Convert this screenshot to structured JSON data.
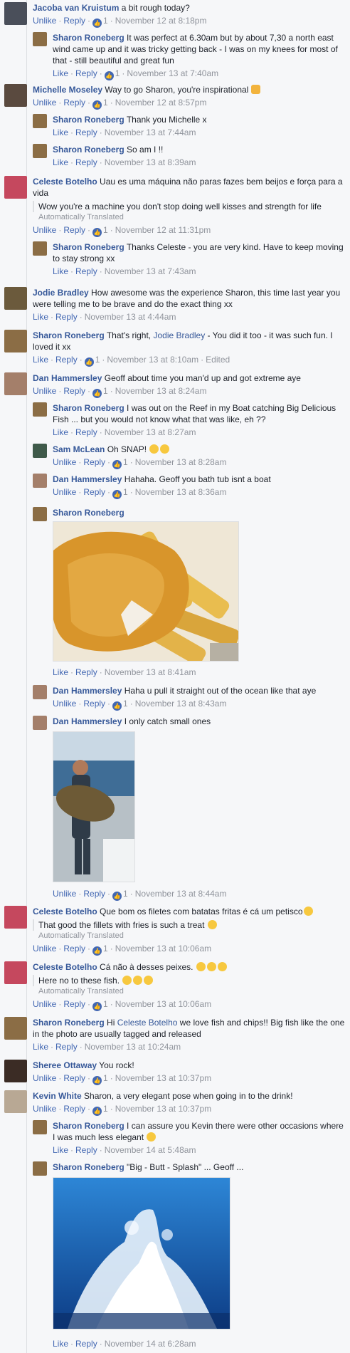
{
  "labels": {
    "unlike": "Unlike",
    "like": "Like",
    "reply": "Reply",
    "like_count_1": "1",
    "sep": "·",
    "auto_translated": "Automatically Translated",
    "edited": "Edited"
  },
  "comments": [
    {
      "author": "Jacoba van Kruistum",
      "text": "a bit rough today?",
      "time": "November 12 at 8:18pm"
    },
    {
      "author": "Sharon Roneberg",
      "text": "It was perfect at 6.30am but by about 7,30 a north east wind came up and it was tricky getting back - I was on my knees for most of that - still beautiful and great fun",
      "time": "November 13 at 7:40am"
    },
    {
      "author": "Michelle Moseley",
      "text": "Way to go Sharon, you're inspirational",
      "time": "November 12 at 8:57pm"
    },
    {
      "author": "Sharon Roneberg",
      "text": "Thank you Michelle x",
      "time": "November 13 at 7:44am"
    },
    {
      "author": "Sharon Roneberg",
      "text": "So am I !!",
      "time": "November 13 at 8:39am"
    },
    {
      "author": "Celeste Botelho",
      "text": "Uau es uma máquina não paras fazes bem beijos e força para a vida",
      "translation": "Wow you're a machine you don't stop doing well kisses and strength for life",
      "time": "November 12 at 11:31pm"
    },
    {
      "author": "Sharon Roneberg",
      "text": "Thanks Celeste - you are very kind. Have to keep moving to stay strong xx",
      "time": "November 13 at 7:43am"
    },
    {
      "author": "Jodie Bradley",
      "text": "How awesome was the experience Sharon, this time last year you were telling me to be brave and do the exact thing xx",
      "time": "November 13 at 4:44am"
    },
    {
      "author": "Sharon Roneberg",
      "text_a": "That's right,",
      "mention": "Jodie Bradley",
      "text_b": "- You did it too - it was such fun. I loved it xx",
      "time": "November 13 at 8:10am"
    },
    {
      "author": "Dan Hammersley",
      "text": "Geoff about time you man'd up and got extreme aye",
      "time": "November 13 at 8:24am"
    },
    {
      "author": "Sharon Roneberg",
      "text": "I was out on the Reef in my Boat catching Big Delicious Fish ... but you would not know what that was like, eh ??",
      "time": "November 13 at 8:27am"
    },
    {
      "author": "Sam McLean",
      "text": "Oh SNAP!",
      "time": "November 13 at 8:28am"
    },
    {
      "author": "Dan Hammersley",
      "text": "Hahaha. Geoff you bath tub isnt a boat",
      "time": "November 13 at 8:36am"
    },
    {
      "author": "Sharon Roneberg",
      "time": "November 13 at 8:41am"
    },
    {
      "author": "Dan Hammersley",
      "text": "Haha u pull it straight out of the ocean like that aye",
      "time": "November 13 at 8:43am"
    },
    {
      "author": "Dan Hammersley",
      "text": "I only catch small ones",
      "time": "November 13 at 8:44am"
    },
    {
      "author": "Celeste Botelho",
      "text": "Que bom os filetes com batatas fritas é cá um petisco",
      "translation": "That good the fillets with fries is such a treat",
      "time": "November 13 at 10:06am"
    },
    {
      "author": "Celeste Botelho",
      "text": "Cá não à desses peixes.",
      "translation": "Here no to these fish.",
      "time": "November 13 at 10:06am"
    },
    {
      "author": "Sharon Roneberg",
      "text_a": "Hi",
      "mention": "Celeste Botelho",
      "text_b": "we love fish and chips!! Big fish like the one in the photo are usually tagged and released",
      "time": "November 13 at 10:24am"
    },
    {
      "author": "Sheree Ottaway",
      "text": "You rock!",
      "time": "November 13 at 10:37pm"
    },
    {
      "author": "Kevin White",
      "text": "Sharon, a very elegant pose when going in to the drink!",
      "time": "November 13 at 10:37pm"
    },
    {
      "author": "Sharon Roneberg",
      "text": "I can assure you Kevin there were other occasions where I was much less elegant",
      "time": "November 14 at 5:48am"
    },
    {
      "author": "Sharon Roneberg",
      "text": "\"Big - Butt - Splash\" ... Geoff ...",
      "time": "November 14 at 6:28am"
    }
  ],
  "colors": {
    "link": "#365899",
    "action": "#4267b2",
    "meta": "#90949c",
    "background": "#f6f7f9"
  },
  "icons": [
    "like-badge-icon",
    "thumbs-up-emoji",
    "laughing-emoji",
    "smiling-emoji",
    "sad-emoji"
  ]
}
